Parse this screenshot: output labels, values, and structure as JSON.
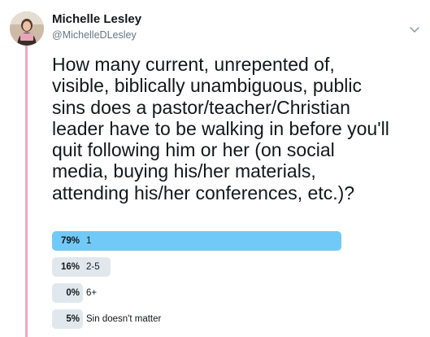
{
  "author": {
    "name": "Michelle Lesley",
    "handle": "@MichelleDLesley",
    "avatar_icon": "profile-photo"
  },
  "tweet": {
    "lines": [
      "How many current, unrepented of,",
      "visible, biblically unambiguous, public",
      "sins does a pastor/teacher/Christian",
      "leader have to be walking in before you'll",
      "quit following him or her (on social",
      "media, buying his/her materials,",
      "attending his/her conferences, etc.)?"
    ]
  },
  "poll": {
    "options": [
      {
        "percent_label": "79%",
        "label": "1",
        "fraction": 0.79,
        "leading": true
      },
      {
        "percent_label": "16%",
        "label": "2-5",
        "fraction": 0.16,
        "leading": false
      },
      {
        "percent_label": "0%",
        "label": "6+",
        "fraction": 0.0,
        "leading": false
      },
      {
        "percent_label": "5%",
        "label": "Sin doesn't matter",
        "fraction": 0.05,
        "leading": false
      }
    ]
  },
  "colors": {
    "thread_line": "#f3a7bf",
    "poll_leader": "#71c9f8",
    "poll_other": "#e1e8ed",
    "handle_text": "#657786"
  },
  "icons": {
    "menu_caret": "chevron-down-icon"
  }
}
